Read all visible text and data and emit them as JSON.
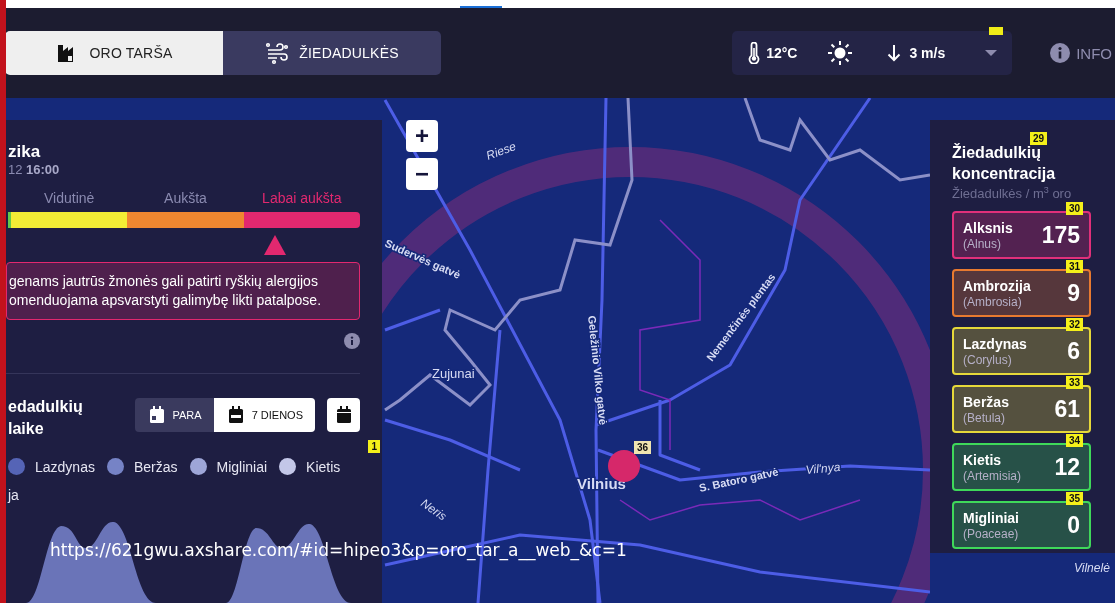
{
  "tabs": [
    {
      "label": "ORO TARŠA",
      "kind": "factory",
      "selected": true
    },
    {
      "label": "ŽIEDADULKĖS",
      "kind": "pollen",
      "selected": false
    }
  ],
  "weather": {
    "temperature": "12°C",
    "wind": "3 m/s"
  },
  "info_link": "INFO",
  "left_panel": {
    "title": "zika",
    "date": "12 **16:00**",
    "scale": [
      {
        "color": "#62c94a"
      },
      {
        "label": "Vidutinė",
        "color": "#f2ec35",
        "selected": false
      },
      {
        "label": "Aukšta",
        "color": "#ef8730",
        "selected": false
      },
      {
        "label": "Labai aukšta",
        "color": "#e2286f",
        "selected": true
      }
    ],
    "marker": {
      "level": 0.76
    },
    "message": "genams jautrūs žmonės gali patirti ryškių alergijos\nomenduojama apsvarstyti galimybę likti patalpose.",
    "section_title": "edadulkių\nlaike",
    "period_toggle": [
      {
        "label": "PARA",
        "selected": false
      },
      {
        "label": "7 DIENOS",
        "selected": true
      }
    ],
    "legend": [
      {
        "label": "Lazdynas",
        "color": "#5564b6"
      },
      {
        "label": "Beržas",
        "color": "#7683c6"
      },
      {
        "label": "Migliniai",
        "color": "#9ea6d8"
      },
      {
        "label": "Kietis",
        "color": "#c3c7e8"
      },
      {
        "label": "ja"
      }
    ],
    "legend_note": "1"
  },
  "map": {
    "labels": [
      {
        "text": "Riese",
        "kind": "water"
      },
      {
        "text": "Sudervės gatvė",
        "kind": "street"
      },
      {
        "text": "Zujunai",
        "kind": "place"
      },
      {
        "text": "Geležinio Vilko gatvė",
        "kind": "street"
      },
      {
        "text": "Nemenčinės plentas",
        "kind": "street"
      },
      {
        "text": "Vilnius",
        "kind": "city"
      },
      {
        "text": "S. Batoro gatvė",
        "kind": "street"
      },
      {
        "text": "Vil'nya",
        "kind": "water"
      },
      {
        "text": "Neris",
        "kind": "water"
      },
      {
        "text": "Vilnelė",
        "kind": "water"
      }
    ],
    "zoom_in": "+",
    "zoom_out": "−",
    "marker_note": "36"
  },
  "concentration_panel": {
    "title": "Žiedadulkių koncentracija",
    "note": "29",
    "unit": "Žiedadulkės / m$^{3}$ oro",
    "items": [
      {
        "name": "Alksnis",
        "latin": "(Alnus)",
        "value": "175",
        "color": "#e0307a",
        "note": "30"
      },
      {
        "name": "Ambrozija",
        "latin": "(Ambrosia)",
        "value": "9",
        "color": "#e87a30",
        "note": "31"
      },
      {
        "name": "Lazdynas",
        "latin": "(Corylus)",
        "value": "6",
        "color": "#e6d83a",
        "note": "32"
      },
      {
        "name": "Beržas",
        "latin": "(Betula)",
        "value": "61",
        "color": "#e6d83a",
        "note": "33"
      },
      {
        "name": "Kietis",
        "latin": "(Artemisia)",
        "value": "12",
        "color": "#3fd85a",
        "note": "34"
      },
      {
        "name": "Migliniai",
        "latin": "(Poaceae)",
        "value": "0",
        "color": "#3fd85a",
        "note": "35"
      }
    ]
  },
  "url_overlay": "https://621gwu.axshare.com/#id=hipeo3&p=oro_tar_a__web_&c=1"
}
